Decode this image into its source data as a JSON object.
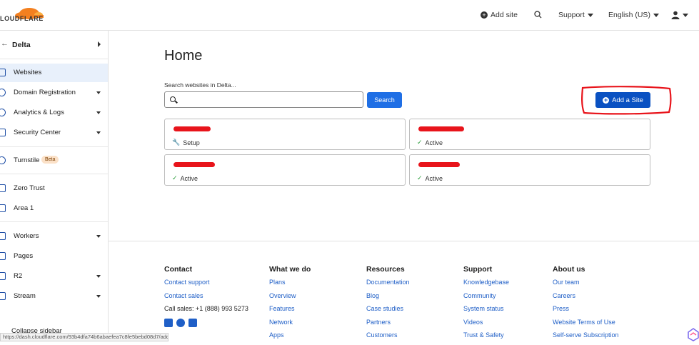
{
  "header": {
    "logo_text": "LOUDFLARE",
    "add_site": "Add site",
    "support": "Support",
    "language": "English (US)"
  },
  "sidebar": {
    "account": "Delta",
    "items": [
      {
        "label": "Websites",
        "active": true,
        "caret": false
      },
      {
        "label": "Domain Registration",
        "caret": true
      },
      {
        "label": "Analytics & Logs",
        "caret": true
      },
      {
        "label": "Security Center",
        "caret": true
      },
      {
        "label": "Turnstile",
        "caret": false,
        "badge": "Beta"
      },
      {
        "label": "Zero Trust",
        "caret": false
      },
      {
        "label": "Area 1",
        "caret": false
      },
      {
        "label": "Workers",
        "caret": true
      },
      {
        "label": "Pages",
        "caret": false
      },
      {
        "label": "R2",
        "caret": true
      },
      {
        "label": "Stream",
        "caret": true
      }
    ],
    "collapse": "Collapse sidebar"
  },
  "status_url": "https://dash.cloudflare.com/93b4dfa74b6abaefea7c8fe5bebd08d7/add-site",
  "main": {
    "title": "Home",
    "search_label": "Search websites in Delta...",
    "search_button": "Search",
    "add_site_button": "Add a Site",
    "sites": [
      {
        "status": "Setup",
        "status_icon": "wrench-icon"
      },
      {
        "status": "Active",
        "status_icon": "check-icon"
      },
      {
        "status": "Active",
        "status_icon": "check-icon"
      },
      {
        "status": "Active",
        "status_icon": "check-icon"
      }
    ]
  },
  "footer": {
    "contact": {
      "heading": "Contact",
      "links": [
        "Contact support",
        "Contact sales"
      ],
      "sales_phone": "Call sales: +1 (888) 993 5273"
    },
    "what_we_do": {
      "heading": "What we do",
      "links": [
        "Plans",
        "Overview",
        "Features",
        "Network",
        "Apps"
      ]
    },
    "resources": {
      "heading": "Resources",
      "links": [
        "Documentation",
        "Blog",
        "Case studies",
        "Partners",
        "Customers"
      ]
    },
    "support": {
      "heading": "Support",
      "links": [
        "Knowledgebase",
        "Community",
        "System status",
        "Videos",
        "Trust & Safety"
      ]
    },
    "about": {
      "heading": "About us",
      "links": [
        "Our team",
        "Careers",
        "Press",
        "Website Terms of Use",
        "Self-serve Subscription"
      ]
    }
  },
  "colors": {
    "accent": "#0a51c2",
    "link": "#1f5fc7",
    "brand_orange": "#f38020",
    "annotation_red": "#e8141b"
  }
}
